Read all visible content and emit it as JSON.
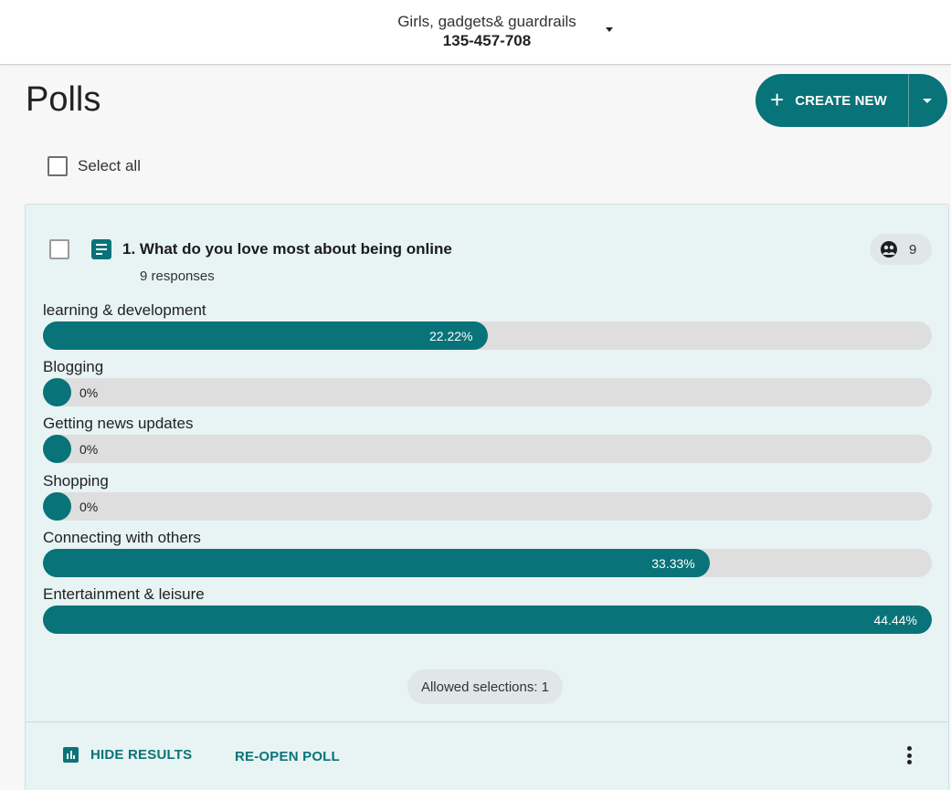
{
  "header": {
    "meeting_name": "Girls, gadgets& guardrails",
    "meeting_id": "135-457-708"
  },
  "page": {
    "title": "Polls",
    "create_button_label": "CREATE NEW",
    "select_all_label": "Select all"
  },
  "poll": {
    "title": "1. What do you love most about being online",
    "responses_label": "9 responses",
    "participant_count": "9",
    "options": [
      {
        "label": "learning & development",
        "percent_label": "22.22%",
        "percent": 22.22
      },
      {
        "label": "Blogging",
        "percent_label": "0%",
        "percent": 0
      },
      {
        "label": "Getting news updates",
        "percent_label": "0%",
        "percent": 0
      },
      {
        "label": "Shopping",
        "percent_label": "0%",
        "percent": 0
      },
      {
        "label": "Connecting with others",
        "percent_label": "33.33%",
        "percent": 33.33
      },
      {
        "label": "Entertainment & leisure",
        "percent_label": "44.44%",
        "percent": 44.44
      }
    ],
    "allowed_selections": "Allowed selections: 1",
    "hide_results_label": "HIDE RESULTS",
    "reopen_label": "RE-OPEN POLL",
    "max_percent": 44.44
  },
  "colors": {
    "accent": "#087378",
    "track": "#dedede",
    "card_background": "#e8f3f4"
  },
  "icons": [
    "chevron-down-icon",
    "plus-icon",
    "poll-question-icon",
    "participants-icon",
    "bar-chart-icon",
    "more-vertical-icon"
  ]
}
